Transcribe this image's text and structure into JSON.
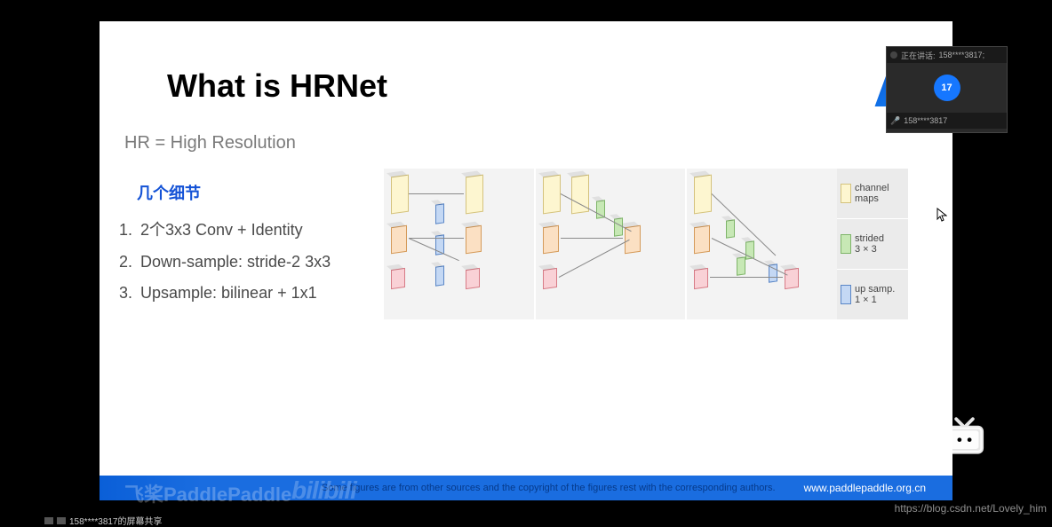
{
  "slide": {
    "title": "What is HRNet",
    "subtitle": "HR = High Resolution",
    "details_heading": "几个细节",
    "details": [
      "2个3x3 Conv + Identity",
      "Down-sample: stride-2 3x3",
      "Upsample: bilinear + 1x1"
    ],
    "legend": {
      "channel": "channel\nmaps",
      "strided": "strided\n3 × 3",
      "upsamp": "up samp.\n1 × 1"
    },
    "corner_glyph": "ナ"
  },
  "footer": {
    "credit": "Some figures are from other sources and the copyright of the figures rest with the corresponding authors.",
    "site": "www.paddlepaddle.org.cn"
  },
  "watermarks": {
    "paddle": "飞桨PaddlePaddle",
    "bili": "bilibili"
  },
  "meeting": {
    "speaking_label": "正在讲话:",
    "speaking_user": "158****3817;",
    "avatar_text": "17",
    "user_label": "158****3817"
  },
  "sharing_bar": "158****3817的屏幕共享",
  "blog": "https://blog.csdn.net/Lovely_him"
}
